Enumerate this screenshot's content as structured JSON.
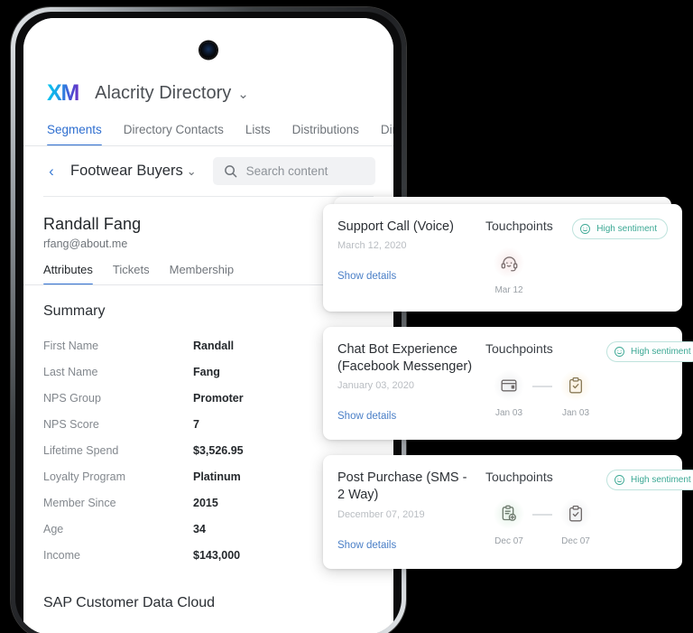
{
  "device": {
    "camera_icon": "front-camera"
  },
  "appbar": {
    "logo_text": "XM",
    "title": "Alacrity Directory",
    "caret_icon": "chevron-down-icon",
    "caret_glyph": "⌄"
  },
  "tabs": [
    {
      "label": "Segments",
      "active": true
    },
    {
      "label": "Directory Contacts",
      "active": false
    },
    {
      "label": "Lists",
      "active": false
    },
    {
      "label": "Distributions",
      "active": false
    },
    {
      "label": "Direct",
      "active": false
    }
  ],
  "subbar": {
    "back_icon": "chevron-left-icon",
    "back_glyph": "‹",
    "segment_name": "Footwear Buyers",
    "segment_caret_icon": "chevron-down-icon",
    "segment_caret_glyph": "⌄",
    "search_icon": "search-icon",
    "search_placeholder": "Search content",
    "search_value": ""
  },
  "person": {
    "name": "Randall Fang",
    "email": "rfang@about.me"
  },
  "subtabs": [
    {
      "label": "Attributes",
      "active": true
    },
    {
      "label": "Tickets",
      "active": false
    },
    {
      "label": "Membership",
      "active": false
    }
  ],
  "summary": {
    "title": "Summary",
    "attributes": [
      {
        "key": "First Name",
        "value": "Randall"
      },
      {
        "key": "Last Name",
        "value": "Fang"
      },
      {
        "key": "NPS Group",
        "value": "Promoter"
      },
      {
        "key": "NPS Score",
        "value": "7"
      },
      {
        "key": "Lifetime Spend",
        "value": "$3,526.95"
      },
      {
        "key": "Loyalty Program",
        "value": "Platinum"
      },
      {
        "key": "Member Since",
        "value": "2015"
      },
      {
        "key": "Age",
        "value": "34"
      },
      {
        "key": "Income",
        "value": "$143,000"
      }
    ]
  },
  "second_section": {
    "title": "SAP Customer Data Cloud"
  },
  "cards": [
    {
      "title": "Support Call (Voice)",
      "date": "March 12, 2020",
      "show_details": "Show details",
      "touchpoints_label": "Touchpoints",
      "sentiment": {
        "label": "High sentiment",
        "icon": "smiley-icon",
        "color": "#3ba894"
      },
      "touchpoints": [
        {
          "icon": "headset-icon",
          "tint": "tint-rose",
          "date": "Mar 12"
        }
      ]
    },
    {
      "title": "Chat Bot Experience (Facebook Messenger)",
      "date": "January 03, 2020",
      "show_details": "Show details",
      "touchpoints_label": "Touchpoints",
      "sentiment": {
        "label": "High sentiment",
        "icon": "smiley-icon",
        "color": "#3ba894"
      },
      "touchpoints": [
        {
          "icon": "chat-window-icon",
          "tint": "tint-gray",
          "date": "Jan 03"
        },
        {
          "icon": "clipboard-check-icon",
          "tint": "tint-amber",
          "date": "Jan 03"
        }
      ]
    },
    {
      "title": "Post Purchase (SMS - 2 Way)",
      "date": "December 07, 2019",
      "show_details": "Show details",
      "touchpoints_label": "Touchpoints",
      "sentiment": {
        "label": "High sentiment",
        "icon": "smiley-icon",
        "color": "#3ba894"
      },
      "touchpoints": [
        {
          "icon": "sms-survey-icon",
          "tint": "tint-mint",
          "date": "Dec 07"
        },
        {
          "icon": "clipboard-check-icon",
          "tint": "tint-gray",
          "date": "Dec 07"
        }
      ]
    }
  ],
  "colors": {
    "accent_blue": "#2f6fd0",
    "link_blue": "#4a7fc7",
    "sentiment_teal": "#3ba894",
    "background": "#000000",
    "surface": "#ffffff"
  }
}
